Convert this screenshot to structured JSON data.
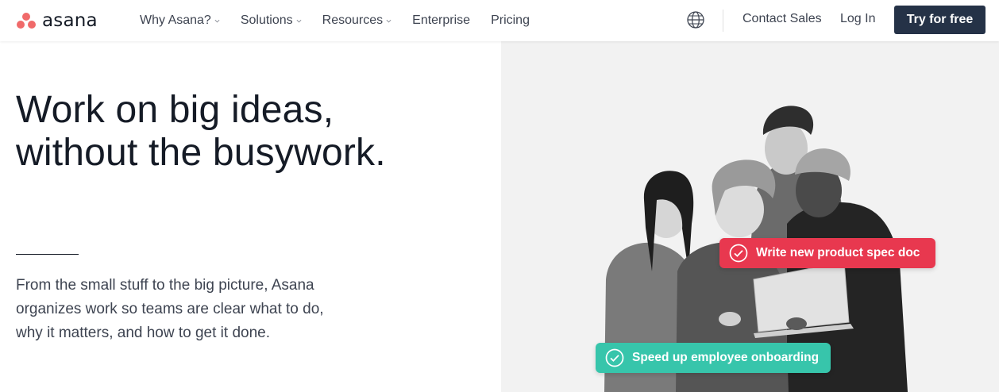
{
  "nav": {
    "logo_text": "asana",
    "menu": [
      {
        "label": "Why Asana?",
        "has_dropdown": true
      },
      {
        "label": "Solutions",
        "has_dropdown": true
      },
      {
        "label": "Resources",
        "has_dropdown": true
      },
      {
        "label": "Enterprise",
        "has_dropdown": false
      },
      {
        "label": "Pricing",
        "has_dropdown": false
      }
    ],
    "language_icon": "globe-icon",
    "contact_sales": "Contact Sales",
    "log_in": "Log In",
    "cta": "Try for free"
  },
  "hero": {
    "headline_line1": "Work on big ideas,",
    "headline_line2": "without the busywork.",
    "subtext": "From the small stuff to the big picture, Asana organizes work so teams are clear what to do, why it matters, and how to get it done.",
    "tasks": [
      {
        "label": "Write new product spec doc",
        "color": "#e8384f",
        "icon": "check-circle-icon"
      },
      {
        "label": "Speed up employee onboarding",
        "color": "#37c5ab",
        "icon": "check-circle-icon"
      }
    ]
  },
  "colors": {
    "brand_coral": "#f06a6a",
    "cta_bg": "#253247",
    "text_dark": "#151b26",
    "panel_bg": "#f2f2f2"
  }
}
